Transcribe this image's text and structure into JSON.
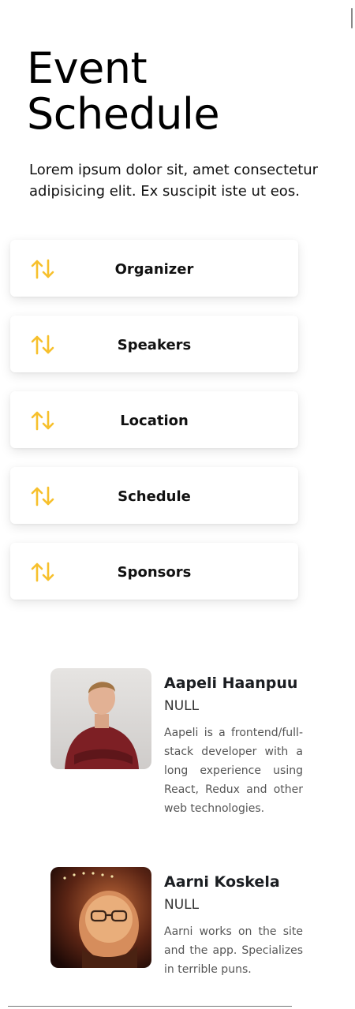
{
  "header": {
    "title_line1": "Event",
    "title_line2": "Schedule",
    "intro": "Lorem ipsum dolor sit, amet consectetur adipisicing elit. Ex suscipit iste ut eos."
  },
  "nav": {
    "items": [
      {
        "label": "Organizer",
        "icon": "sort-arrows-icon"
      },
      {
        "label": "Speakers",
        "icon": "sort-arrows-icon"
      },
      {
        "label": "Location",
        "icon": "sort-arrows-icon"
      },
      {
        "label": "Schedule",
        "icon": "sort-arrows-icon"
      },
      {
        "label": "Sponsors",
        "icon": "sort-arrows-icon"
      }
    ],
    "icon_color": "#f7c02c"
  },
  "speakers": [
    {
      "name": "Aapeli Haanpuu",
      "role": "NULL",
      "bio": "Aapeli is a frontend/full-stack developer with a long experience using React, Redux and other web technologies."
    },
    {
      "name": "Aarni Koskela",
      "role": "NULL",
      "bio": "Aarni works on the site and the app. Specializes in terrible puns."
    }
  ]
}
